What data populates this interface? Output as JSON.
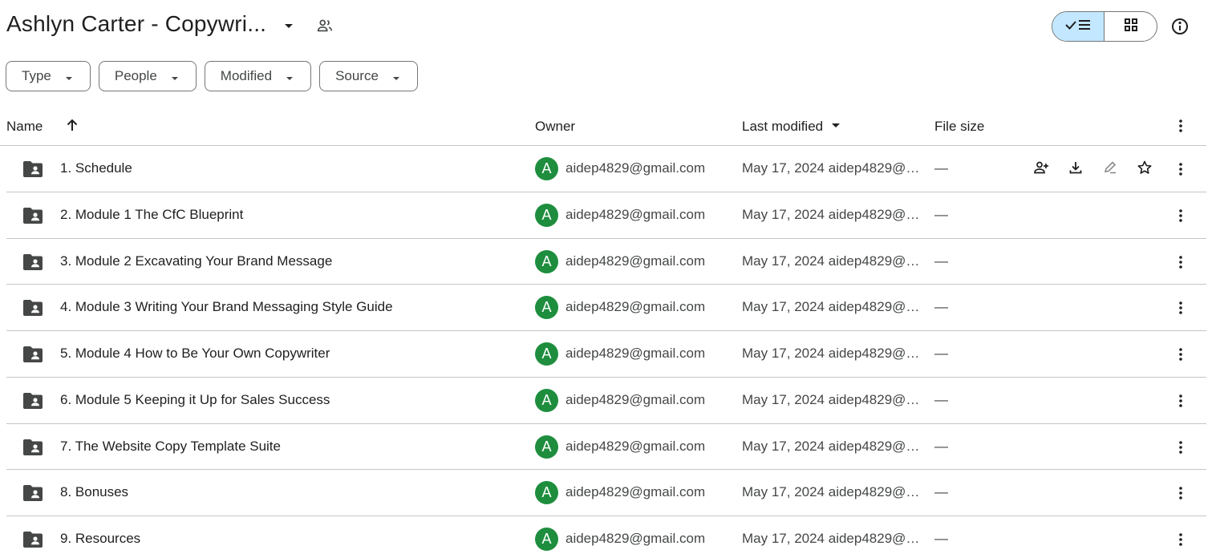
{
  "header": {
    "title": "Ashlyn Carter - Copywri...",
    "title_caret_icon": "arrow-drop-down-icon",
    "share_icon": "people-icon",
    "view_toggle": {
      "list_icon": "check-list-icon",
      "grid_icon": "grid-icon",
      "active": "list"
    },
    "info_icon": "info-icon"
  },
  "filters": [
    {
      "label": "Type"
    },
    {
      "label": "People"
    },
    {
      "label": "Modified"
    },
    {
      "label": "Source"
    }
  ],
  "columns": {
    "name": "Name",
    "owner": "Owner",
    "last_modified": "Last modified",
    "file_size": "File size"
  },
  "files": [
    {
      "name": "1. Schedule",
      "owner_initial": "A",
      "owner": "aidep4829@gmail.com",
      "modified": "May 17, 2024 aidep4829@gmail.com",
      "size": "—",
      "show_actions": true
    },
    {
      "name": "2. Module 1 The CfC Blueprint",
      "owner_initial": "A",
      "owner": "aidep4829@gmail.com",
      "modified": "May 17, 2024 aidep4829@gmail.com",
      "size": "—"
    },
    {
      "name": "3. Module 2 Excavating Your Brand Message",
      "owner_initial": "A",
      "owner": "aidep4829@gmail.com",
      "modified": "May 17, 2024 aidep4829@gmail.com",
      "size": "—"
    },
    {
      "name": "4. Module 3 Writing Your Brand Messaging Style Guide",
      "owner_initial": "A",
      "owner": "aidep4829@gmail.com",
      "modified": "May 17, 2024 aidep4829@gmail.com",
      "size": "—"
    },
    {
      "name": "5. Module 4 How to Be Your Own Copywriter",
      "owner_initial": "A",
      "owner": "aidep4829@gmail.com",
      "modified": "May 17, 2024 aidep4829@gmail.com",
      "size": "—"
    },
    {
      "name": "6. Module 5 Keeping it Up for Sales Success",
      "owner_initial": "A",
      "owner": "aidep4829@gmail.com",
      "modified": "May 17, 2024 aidep4829@gmail.com",
      "size": "—"
    },
    {
      "name": "7. The Website Copy Template Suite",
      "owner_initial": "A",
      "owner": "aidep4829@gmail.com",
      "modified": "May 17, 2024 aidep4829@gmail.com",
      "size": "—"
    },
    {
      "name": "8. Bonuses",
      "owner_initial": "A",
      "owner": "aidep4829@gmail.com",
      "modified": "May 17, 2024 aidep4829@gmail.com",
      "size": "—"
    },
    {
      "name": "9. Resources",
      "owner_initial": "A",
      "owner": "aidep4829@gmail.com",
      "modified": "May 17, 2024 aidep4829@gmail.com",
      "size": "—"
    }
  ],
  "colors": {
    "avatar": "#1e8e3e",
    "toggle_active": "#c2e7ff",
    "border": "#747775",
    "divider": "#c4c7c5"
  }
}
